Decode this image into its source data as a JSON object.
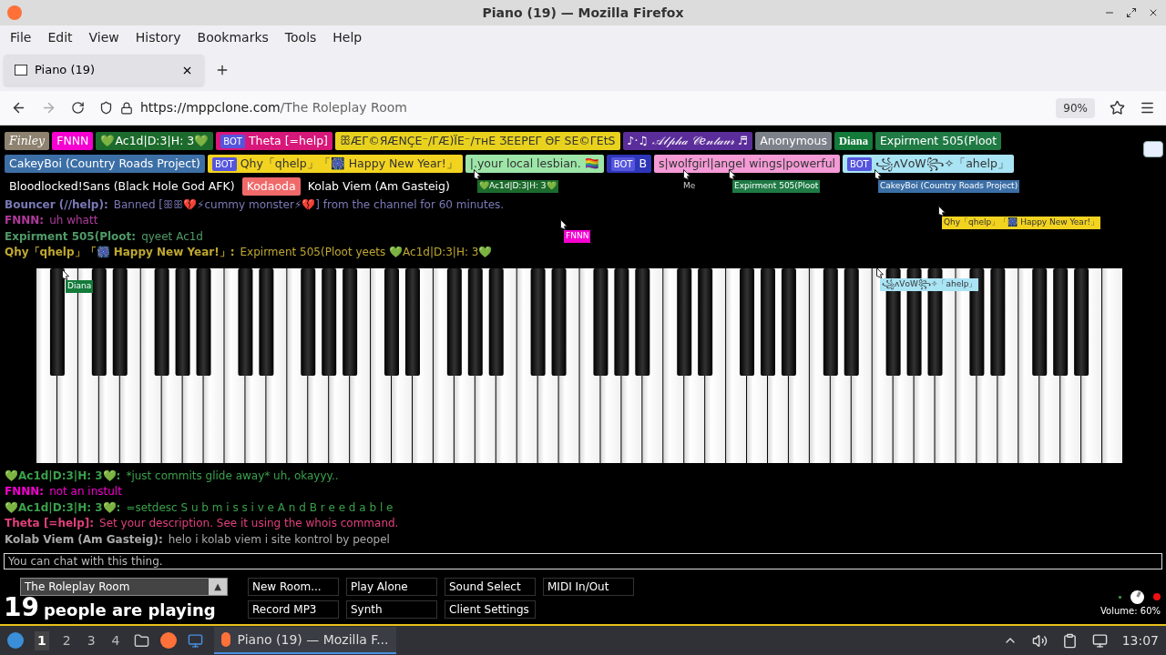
{
  "window": {
    "title": "Piano (19) — Mozilla Firefox"
  },
  "menu": [
    "File",
    "Edit",
    "View",
    "History",
    "Bookmarks",
    "Tools",
    "Help"
  ],
  "tabs": [
    {
      "label": "Piano (19)",
      "selected": true
    }
  ],
  "address": {
    "host": "https://mppclone.com",
    "path": "/The Roleplay Room",
    "zoom": "90%"
  },
  "users": [
    {
      "name": "Finley",
      "color": "#8e8270",
      "kind": "script"
    },
    {
      "name": "FNNN",
      "color": "#f500d0",
      "kind": "plain"
    },
    {
      "name": "💚Ac1d|D:3|H: 3💚",
      "color": "#1c6b2c",
      "kind": "plain"
    },
    {
      "name": "Theta [=help]",
      "color": "#d8177a",
      "kind": "plain",
      "badge": "BOT"
    },
    {
      "name": "ꕥÆΓ©ЯÆNÇE⁻/ΓÆ)ΪE⁻/ᴛʜE ƷEEPEΓ ΘF SE©ΓEtS",
      "color": "#e8d21e",
      "kind": "plain"
    },
    {
      "name": "♪·♫ 𝒜𝓁𝓅𝒽𝒶 𝒞𝑒𝓃𝓉𝒶𝓊𝓇 ♬",
      "color": "#5b2d9a",
      "kind": "script"
    },
    {
      "name": "Anonymous",
      "color": "#7d828a",
      "kind": "plain"
    },
    {
      "name": "Diana",
      "color": "#137a3a",
      "kind": "blackletter"
    },
    {
      "name": "Expirment 505(Ploot",
      "color": "#1f7a44",
      "kind": "plain"
    },
    {
      "name": "CakeyBoi (Country Roads Project)",
      "color": "#3c6fa6",
      "kind": "plain"
    },
    {
      "name": "Qhy「qhelp」「🎆 Happy New Year!」",
      "color": "#f2d320",
      "kind": "plain",
      "badge": "BOT"
    },
    {
      "name": "|.your local lesbian. 🏳️‍🌈",
      "color": "#9de6a8",
      "kind": "plain"
    },
    {
      "name": "B",
      "color": "#2d35b8",
      "kind": "plain",
      "badge": "BOT"
    },
    {
      "name": "s|wolfgirl|angel wings|powerful",
      "color": "#f49ad6",
      "kind": "plain"
    },
    {
      "name": "꧁ᴧVᴏW꧂✧「ahelp」",
      "color": "#a9e4f5",
      "kind": "plain",
      "badge": "BOT"
    },
    {
      "name": "Bloodlocked!Sans (Black Hole God AFK)",
      "color": "#000000",
      "kind": "plain"
    },
    {
      "name": "Kodaoda",
      "color": "#f06a6a",
      "kind": "plain"
    },
    {
      "name": "Kolab Viem (Am Gasteig)",
      "color": "#000000",
      "kind": "plain"
    }
  ],
  "cursors": [
    {
      "name": "💚Ac1d|D:3|H: 3💚",
      "color": "#1c6b2c",
      "kind": "label"
    },
    {
      "name": "Me",
      "kind": "self"
    },
    {
      "name": "Expirment 505(Ploot",
      "color": "#1f7a44",
      "kind": "label"
    },
    {
      "name": "CakeyBoi (Country Roads Project)",
      "color": "#3c6fa6",
      "kind": "label"
    },
    {
      "name": "FNNN",
      "color": "#f500d0",
      "kind": "label"
    },
    {
      "name": "Qhy「qhelp」「🎆 Happy New Year!」",
      "color": "#f2d320",
      "kind": "label"
    },
    {
      "name": "Diana",
      "color": "#137a3a",
      "kind": "label"
    },
    {
      "name": "꧁ᴧVᴏW꧂✧「ahelp」",
      "color": "#a9e4f5",
      "kind": "label"
    }
  ],
  "chat_top": [
    {
      "name": "Bouncer (//help):",
      "text": "Banned [ꕥꕥ💔⚡cummy monster⚡💔] from the channel for 60 minutes.",
      "color": "#7a7ab8"
    },
    {
      "name": "FNNN:",
      "text": "uh whatt",
      "color": "#b03a9c"
    },
    {
      "name": "Expirment 505(Ploot:",
      "text": "qyeet Ac1d",
      "color": "#4f9a68"
    },
    {
      "name": "Qhy「qhelp」「🎆 Happy New Year!」:",
      "text": "Expirment 505(Ploot yeets 💚Ac1d|D:3|H: 3💚",
      "color": "#c0a830"
    }
  ],
  "chat_bottom": [
    {
      "name": "💚Ac1d|D:3|H: 3💚:",
      "text": "*just commits glide away* uh, okayyy..",
      "color": "#3aa04c"
    },
    {
      "name": "FNNN:",
      "text": "not an instult",
      "color": "#f500d0"
    },
    {
      "name": "💚Ac1d|D:3|H: 3💚:",
      "text": "=setdesc S u b m i s s i v e A n d B r e e d a b l e",
      "color": "#3aa04c"
    },
    {
      "name": "Theta [=help]:",
      "text": "Set your description. See it using the whois command.",
      "color": "#e0407a"
    },
    {
      "name": "Kolab Viem (Am Gasteig):",
      "text": "helo i kolab viem i site kontrol by peopel",
      "color": "#aaaaaa"
    }
  ],
  "chat_input": {
    "placeholder": "You can chat with this thing."
  },
  "room": {
    "name": "The Roleplay Room",
    "arrow": "▲"
  },
  "players": {
    "count": "19",
    "label": "people are playing"
  },
  "buttons": [
    "New Room...",
    "Play Alone",
    "Sound Select",
    "MIDI In/Out",
    "Record MP3",
    "Synth",
    "Client Settings"
  ],
  "volume": {
    "label": "Volume: 60%",
    "level": 0.6
  },
  "taskbar": {
    "workspaces": [
      {
        "label": "1",
        "selected": true
      },
      {
        "label": "2",
        "selected": false
      },
      {
        "label": "3",
        "selected": false
      },
      {
        "label": "4",
        "selected": false
      }
    ],
    "task": "Piano (19) — Mozilla F...",
    "time": "13:07"
  }
}
